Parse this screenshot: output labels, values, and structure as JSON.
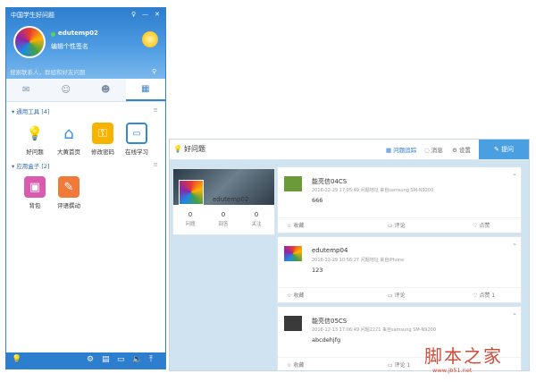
{
  "im": {
    "title": "中国学生好问题",
    "title_controls": [
      "♀",
      "—",
      "✕"
    ],
    "username": "edutemp02",
    "signature": "编辑个性签名",
    "search_placeholder": "搜索联系人，群组和好友问题",
    "search_button": "⚲",
    "tabs": [
      {
        "icon": "chat-icon",
        "glyph": "✉"
      },
      {
        "icon": "contact-icon",
        "glyph": "☺"
      },
      {
        "icon": "group-icon",
        "glyph": "☻"
      },
      {
        "icon": "apps-icon",
        "glyph": "▦"
      }
    ],
    "groups": [
      {
        "label": "通用工具",
        "count": "[4]",
        "more": "≡"
      },
      {
        "label": "应用盒子",
        "count": "[2]",
        "more": "≡"
      }
    ],
    "apps_common": [
      {
        "label": "好问题",
        "icon": "lightbulb-icon",
        "glyph": "💡",
        "color": "#ffffff"
      },
      {
        "label": "大黄首页",
        "icon": "home-icon",
        "glyph": "⌂",
        "color": "#3a8fd8"
      },
      {
        "label": "修改密码",
        "icon": "key-icon",
        "glyph": "⚿",
        "color": "#f6b400"
      },
      {
        "label": "在线学习",
        "icon": "study-icon",
        "glyph": "☐",
        "color": "#2f8ad1"
      }
    ],
    "apps_box": [
      {
        "label": "背包",
        "icon": "backpack-icon",
        "glyph": "▣",
        "color": "#d95bb0"
      },
      {
        "label": "评语撰动",
        "icon": "comment-icon",
        "glyph": "✎",
        "color": "#f07a3a"
      }
    ],
    "footer_icons": [
      "⚙",
      "▤",
      "▭",
      "🔈",
      "⤒"
    ]
  },
  "qa": {
    "logo": "好问题",
    "nav": [
      {
        "label": "问题追踪",
        "icon": "tracking-icon",
        "glyph": "▦",
        "active": true
      },
      {
        "label": "消息",
        "icon": "message-icon",
        "glyph": "◌",
        "active": false
      },
      {
        "label": "设置",
        "icon": "settings-icon",
        "glyph": "⚙",
        "active": false
      }
    ],
    "ask_button": "提问",
    "profile": {
      "name": "edutemp02",
      "stats": [
        {
          "value": "0",
          "label": "问题"
        },
        {
          "value": "0",
          "label": "回答"
        },
        {
          "value": "0",
          "label": "关注"
        }
      ]
    },
    "posts": [
      {
        "name": "能亮信04CS",
        "meta": "2016-12-29 17:05:49  问题地址  来自samsung SM-N9200",
        "text": "666",
        "actions": [
          "收藏",
          "评论",
          "点赞"
        ],
        "avatar_color": "#6b9a3a"
      },
      {
        "name": "edutemp04",
        "meta": "2016-12-29 10:56:27  问题地址  来自iPhone",
        "text": "123",
        "actions": [
          "收藏",
          "评论",
          "点赞 1"
        ],
        "avatar_color": "#e05c3a"
      },
      {
        "name": "能亮信05CS",
        "meta": "2016-12-13 17:06:49  问题2221  来自samsung SM-N9200",
        "text": "abcdehjfg",
        "actions": [
          "收藏",
          "评论 1",
          ""
        ],
        "avatar_color": "#3a3a3a"
      }
    ]
  },
  "watermark": {
    "text": "脚本之家",
    "url": "www.jb51.net"
  }
}
